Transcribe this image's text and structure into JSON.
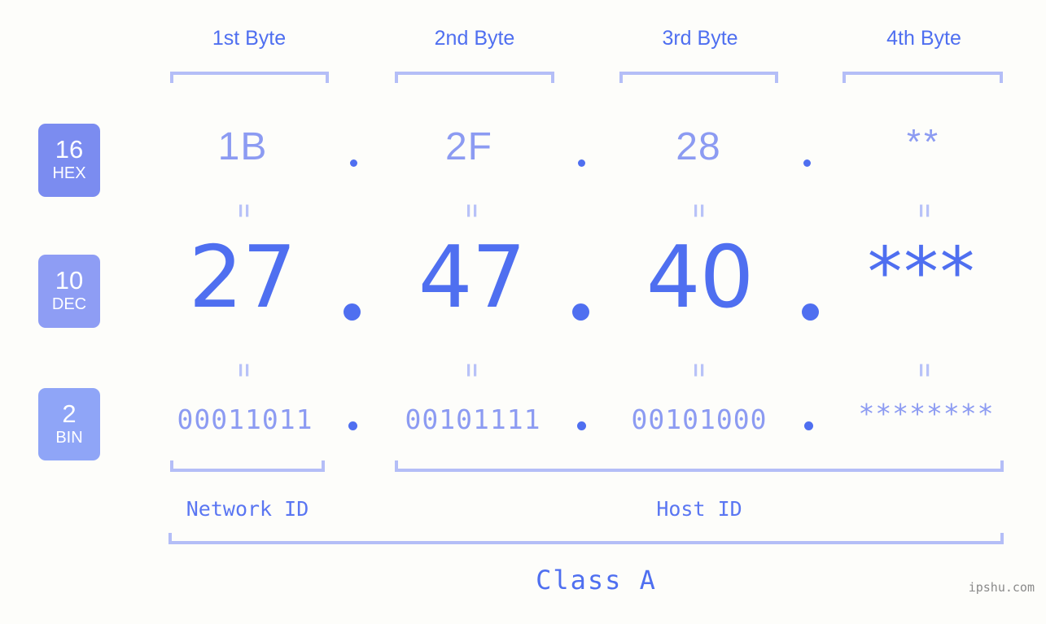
{
  "page": {
    "background_color": "#fdfdfa",
    "accent_color": "#4f6ff0",
    "accent_light_color": "#8c9bf2",
    "bracket_color": "#b4bef7",
    "watermark": "ipshu.com"
  },
  "byte_headers": [
    {
      "label": "1st Byte"
    },
    {
      "label": "2nd Byte"
    },
    {
      "label": "3rd Byte"
    },
    {
      "label": "4th Byte"
    }
  ],
  "bases": [
    {
      "number": "16",
      "name": "HEX",
      "color": "#7b8cf0"
    },
    {
      "number": "10",
      "name": "DEC",
      "color": "#8e9df4"
    },
    {
      "number": "2",
      "name": "BIN",
      "color": "#8fa5f7"
    }
  ],
  "rows": {
    "hex": {
      "base_number": "16",
      "base_name": "HEX",
      "values": [
        "1B",
        "2F",
        "28",
        "**"
      ],
      "separator": "."
    },
    "dec": {
      "base_number": "10",
      "base_name": "DEC",
      "values": [
        "27",
        "47",
        "40",
        "***"
      ],
      "separator": "."
    },
    "bin": {
      "base_number": "2",
      "base_name": "BIN",
      "values": [
        "00011011",
        "00101111",
        "00101000",
        "********"
      ],
      "separator": "."
    }
  },
  "equals_marker": "=",
  "id_labels": {
    "network": "Network ID",
    "host": "Host ID"
  },
  "class_label": "Class A"
}
